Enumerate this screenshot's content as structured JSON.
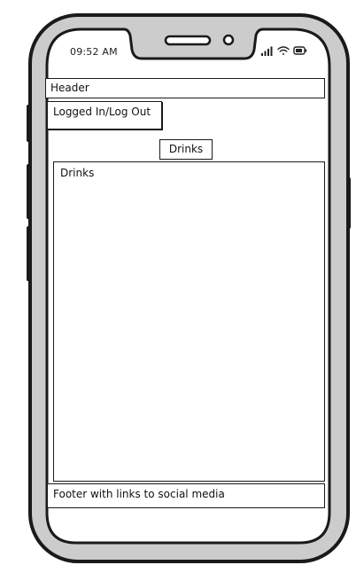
{
  "status_bar": {
    "time": "09:52 AM",
    "icons": [
      "signal-icon",
      "wifi-icon",
      "battery-icon"
    ]
  },
  "header": {
    "label": "Header"
  },
  "auth": {
    "label": "Logged In/Log Out"
  },
  "drinks_button": {
    "label": "Drinks"
  },
  "drinks_panel": {
    "title": "Drinks"
  },
  "footer": {
    "label": "Footer with links to social media"
  },
  "colors": {
    "frame": "#1a1a1a",
    "bezel": "#cccccc",
    "screen": "#ffffff"
  }
}
